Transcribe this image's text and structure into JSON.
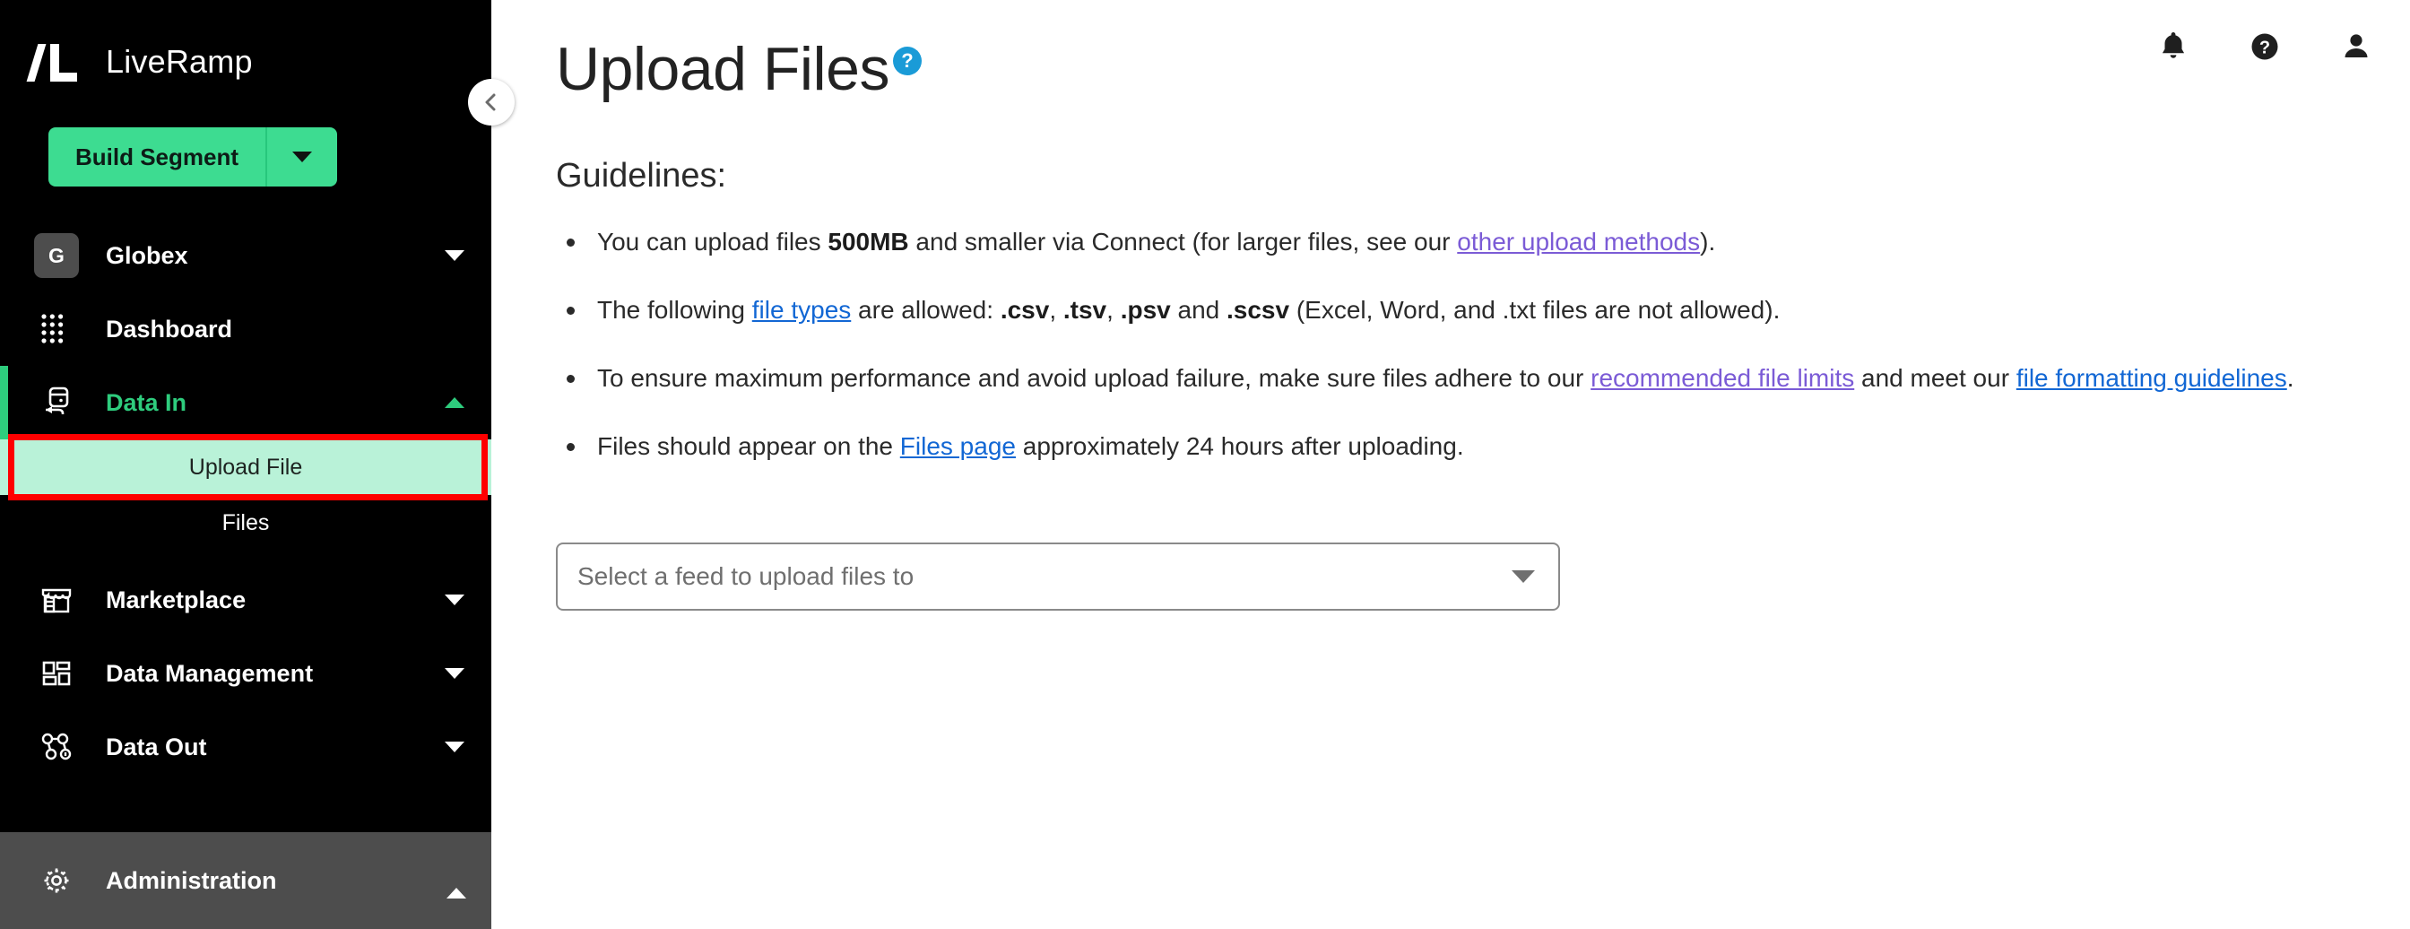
{
  "brand": {
    "name": "LiveRamp",
    "logo_icon": "liveramp-logo-icon"
  },
  "sidebar": {
    "build_button": {
      "label": "Build Segment",
      "caret_icon": "caret-down-icon"
    },
    "collapse_icon": "chevron-left-icon",
    "items": [
      {
        "label": "Globex",
        "icon": "tenant-badge-icon",
        "badge": "G",
        "chevron": "chevron-down-icon",
        "state": "collapsed"
      },
      {
        "label": "Dashboard",
        "icon": "dashboard-grid-icon",
        "chevron": "",
        "state": "none"
      },
      {
        "label": "Data In",
        "icon": "data-in-icon",
        "chevron": "chevron-up-icon",
        "state": "expanded-active"
      },
      {
        "label": "Marketplace",
        "icon": "marketplace-storefront-icon",
        "chevron": "chevron-down-icon",
        "state": "collapsed"
      },
      {
        "label": "Data Management",
        "icon": "data-management-layout-icon",
        "chevron": "chevron-down-icon",
        "state": "collapsed"
      },
      {
        "label": "Data Out",
        "icon": "data-out-nodes-icon",
        "chevron": "chevron-down-icon",
        "state": "collapsed"
      }
    ],
    "sub_items": [
      {
        "label": "Upload File",
        "selected": true,
        "highlighted": true
      },
      {
        "label": "Files",
        "selected": false,
        "highlighted": false
      }
    ],
    "administration": {
      "label": "Administration",
      "icon": "gear-icon",
      "chevron": "chevron-up-icon"
    }
  },
  "header": {
    "title": "Upload Files",
    "help_badge": "?",
    "icons": [
      {
        "name": "notifications-bell-icon"
      },
      {
        "name": "help-circle-icon"
      },
      {
        "name": "user-account-icon"
      }
    ]
  },
  "main": {
    "guidelines_heading": "Guidelines:",
    "bullets": [
      {
        "parts": [
          {
            "t": "You can upload files ",
            "k": "text"
          },
          {
            "t": "500MB",
            "k": "bold"
          },
          {
            "t": " and smaller via Connect (for larger files, see our ",
            "k": "text"
          },
          {
            "t": "other upload methods",
            "k": "link-purple"
          },
          {
            "t": ").",
            "k": "text"
          }
        ]
      },
      {
        "parts": [
          {
            "t": "The following ",
            "k": "text"
          },
          {
            "t": "file types",
            "k": "link-blue"
          },
          {
            "t": " are allowed: ",
            "k": "text"
          },
          {
            "t": ".csv",
            "k": "bold"
          },
          {
            "t": ", ",
            "k": "text"
          },
          {
            "t": ".tsv",
            "k": "bold"
          },
          {
            "t": ", ",
            "k": "text"
          },
          {
            "t": ".psv",
            "k": "bold"
          },
          {
            "t": " and ",
            "k": "text"
          },
          {
            "t": ".scsv",
            "k": "bold"
          },
          {
            "t": " (Excel, Word, and .txt files are not allowed).",
            "k": "text"
          }
        ]
      },
      {
        "parts": [
          {
            "t": "To ensure maximum performance and avoid upload failure, make sure files adhere to our ",
            "k": "text"
          },
          {
            "t": "recommended file limits",
            "k": "link-purple"
          },
          {
            "t": " and meet our ",
            "k": "text"
          },
          {
            "t": "file formatting guidelines",
            "k": "link-blue"
          },
          {
            "t": ".",
            "k": "text"
          }
        ]
      },
      {
        "parts": [
          {
            "t": "Files should appear on the ",
            "k": "text"
          },
          {
            "t": "Files page",
            "k": "link-blue"
          },
          {
            "t": " approximately 24 hours after uploading.",
            "k": "text"
          }
        ]
      }
    ],
    "feed_select": {
      "placeholder": "Select a feed to upload files to",
      "caret_icon": "caret-down-icon"
    }
  },
  "colors": {
    "sidebar_bg": "#000000",
    "accent_green": "#3ddc91",
    "active_green": "#2ecc7d",
    "selected_sub_bg": "#b9f2d8",
    "highlight_red": "#ff0000",
    "link_blue": "#1267d4",
    "link_purple": "#7b5bd6",
    "admin_bg": "#4d4d4d",
    "help_badge_blue": "#1a9bd7"
  }
}
